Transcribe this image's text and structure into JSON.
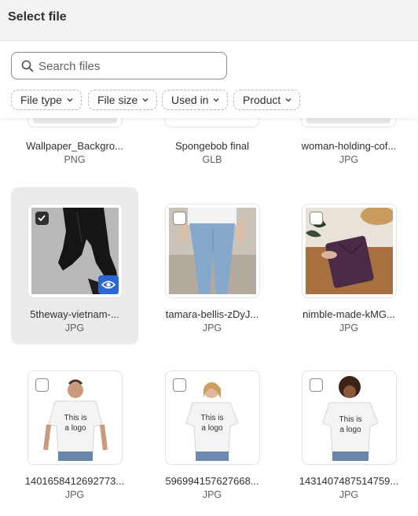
{
  "header": {
    "title": "Select file"
  },
  "search": {
    "placeholder": "Search files",
    "value": ""
  },
  "filters": [
    {
      "label": "File type"
    },
    {
      "label": "File size"
    },
    {
      "label": "Used in"
    },
    {
      "label": "Product"
    }
  ],
  "files": [
    {
      "name": "Wallpaper_Backgro...",
      "type": "PNG",
      "selected": false
    },
    {
      "name": "Spongebob final",
      "type": "GLB",
      "selected": false
    },
    {
      "name": "woman-holding-cof...",
      "type": "JPG",
      "selected": false
    },
    {
      "name": "5theway-vietnam-...",
      "type": "JPG",
      "selected": true
    },
    {
      "name": "tamara-bellis-zDyJ...",
      "type": "JPG",
      "selected": false
    },
    {
      "name": "nimble-made-kMG...",
      "type": "JPG",
      "selected": false
    },
    {
      "name": "1401658412692773...",
      "type": "JPG",
      "selected": false
    },
    {
      "name": "596994157627668...",
      "type": "JPG",
      "selected": false
    },
    {
      "name": "1431407487514759...",
      "type": "JPG",
      "selected": false
    }
  ],
  "tshirt_text": [
    "This is",
    "a logo"
  ],
  "colors": {
    "accent": "#2a66d4",
    "selected_bg": "#ebebeb",
    "checkbox_on": "#303030"
  }
}
